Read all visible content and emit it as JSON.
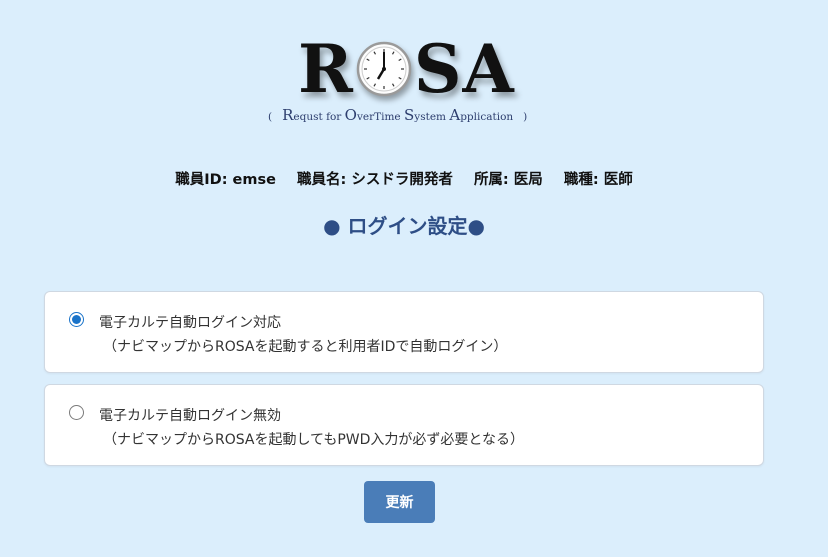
{
  "logo": {
    "letters_left": "R",
    "letters_right": "SA",
    "subtitle_open": "(",
    "subtitle_close": ")",
    "subtitle_words": [
      {
        "cap": "R",
        "rest": "equst for "
      },
      {
        "cap": "O",
        "rest": "verTime "
      },
      {
        "cap": "S",
        "rest": "ystem "
      },
      {
        "cap": "A",
        "rest": "pplication"
      }
    ]
  },
  "info": {
    "staff_id": "職員ID: emse",
    "staff_name": "職員名: シスドラ開発者",
    "department": "所属: 医局",
    "job_type": "職種: 医師"
  },
  "heading": "● ログイン設定●",
  "options": [
    {
      "title": "電子カルテ自動ログイン対応",
      "description": "（ナビマップからROSAを起動すると利用者IDで自動ログイン）",
      "checked": true
    },
    {
      "title": "電子カルテ自動ログイン無効",
      "description": "（ナビマップからROSAを起動してもPWD入力が必ず必要となる）",
      "checked": false
    }
  ],
  "update_button": "更新",
  "colors": {
    "background": "#dbeefc",
    "heading": "#2e4e86",
    "button": "#4a7db8",
    "radio_checked": "#1a73c9"
  }
}
